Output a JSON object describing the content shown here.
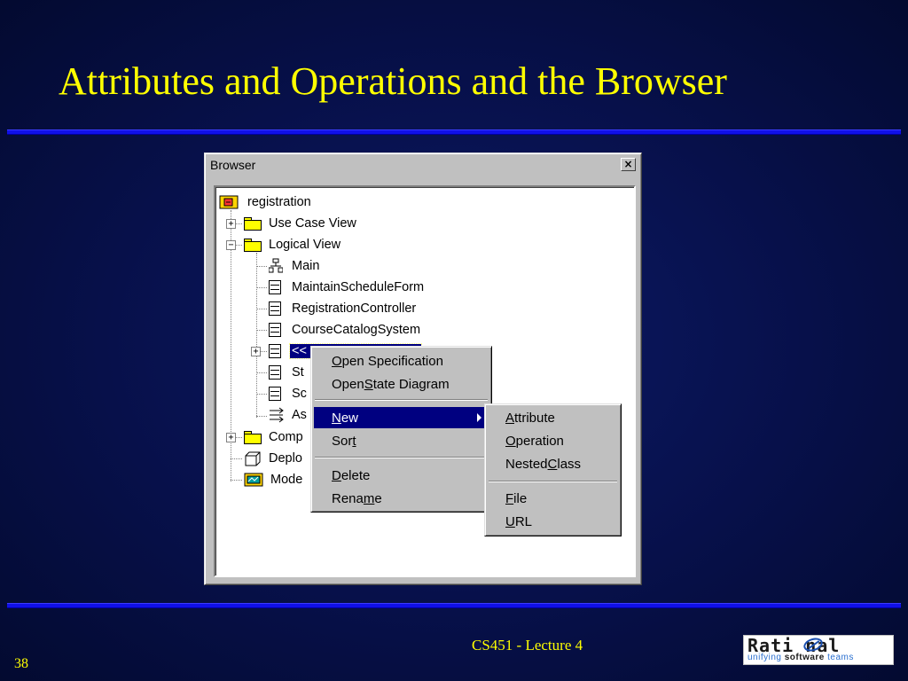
{
  "slide": {
    "title": "Attributes and Operations and the Browser",
    "footer": "CS451 - Lecture 4",
    "page_number": "38",
    "logo": {
      "word": "Rati nal",
      "tag_a": "unifying ",
      "tag_b": "software",
      "tag_c": " teams"
    }
  },
  "browser": {
    "title": "Browser",
    "close_glyph": "×",
    "tree": {
      "root": "registration",
      "use_case_view": "Use Case View",
      "logical_view": "Logical View",
      "main": "Main",
      "maintain_schedule_form": "MaintainScheduleForm",
      "registration_controller": "RegistrationController",
      "course_catalog_system": "CourseCatalogSystem",
      "selected_prefix": "<<",
      "partial_1": "St",
      "partial_2": "Sc",
      "partial_3": "As",
      "component_partial": "Comp",
      "deployment_partial": "Deplo",
      "model_partial": "Mode"
    },
    "expand_plus": "+",
    "expand_minus": "−"
  },
  "context_menu": {
    "open_spec": {
      "u": "O",
      "rest": "pen Specification"
    },
    "open_state": {
      "pre": "Open ",
      "u": "S",
      "rest": "tate Diagram"
    },
    "new": {
      "u": "N",
      "rest": "ew"
    },
    "sort": {
      "pre": "Sor",
      "u": "t",
      "rest": ""
    },
    "delete": {
      "u": "D",
      "rest": "elete"
    },
    "rename": {
      "pre": "Rena",
      "u": "m",
      "rest": "e"
    }
  },
  "submenu": {
    "attribute": {
      "u": "A",
      "rest": "ttribute"
    },
    "operation": {
      "u": "O",
      "rest": "peration"
    },
    "nested_class": {
      "pre": "Nested ",
      "u": "C",
      "rest": "lass"
    },
    "file": {
      "u": "F",
      "rest": "ile"
    },
    "url": {
      "u": "U",
      "rest": "RL"
    }
  }
}
